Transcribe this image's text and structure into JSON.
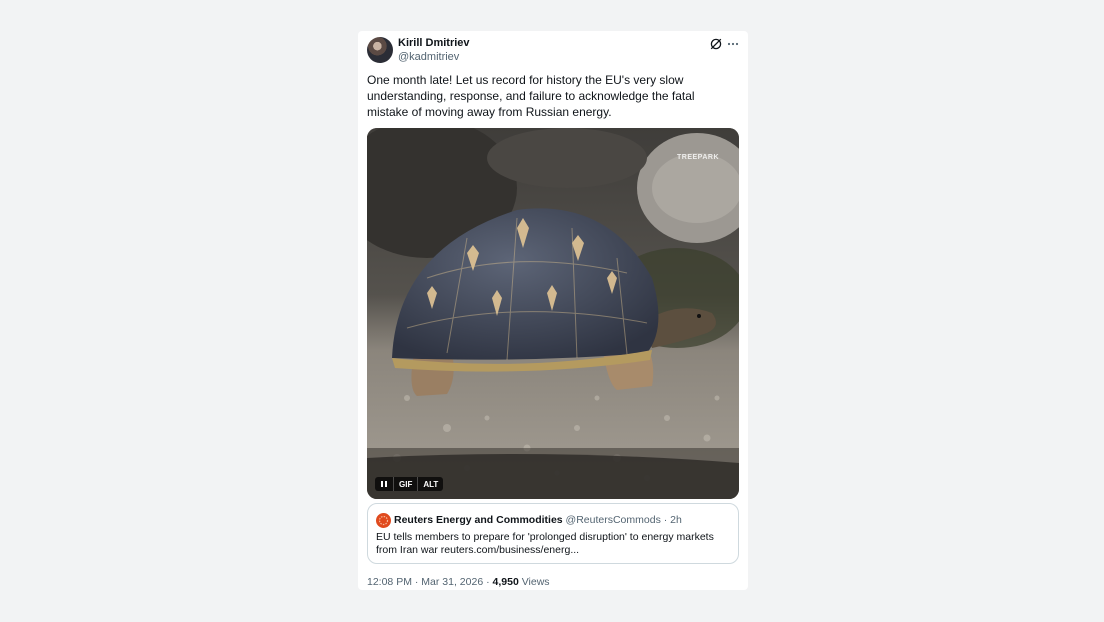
{
  "author": {
    "name": "Kirill Dmitriev",
    "handle": "@kadmitriev"
  },
  "tweet": {
    "text": "One month late! Let us record for history the EU's very slow understanding, response, and failure to acknowledge the fatal mistake of moving away from Russian energy."
  },
  "media": {
    "watermark": "TREEPARK",
    "controls": {
      "gif_label": "GIF",
      "alt_label": "ALT"
    }
  },
  "quote": {
    "name": "Reuters Energy and Commodities",
    "handle": "@ReutersCommods",
    "separator": "·",
    "time": "2h",
    "text": "EU tells members to prepare for 'prolonged disruption' to energy markets from Iran war reuters.com/business/energ..."
  },
  "meta": {
    "time": "12:08 PM",
    "date": "Mar 31, 2026",
    "separator": "·",
    "views_count": "4,950",
    "views_label": "Views"
  },
  "icons": {
    "grok": "grok-icon",
    "more": "more-icon"
  },
  "colors": {
    "text_primary": "#0f1419",
    "text_secondary": "#536471",
    "background": "#f2f3f4",
    "border": "#cfd9de"
  }
}
